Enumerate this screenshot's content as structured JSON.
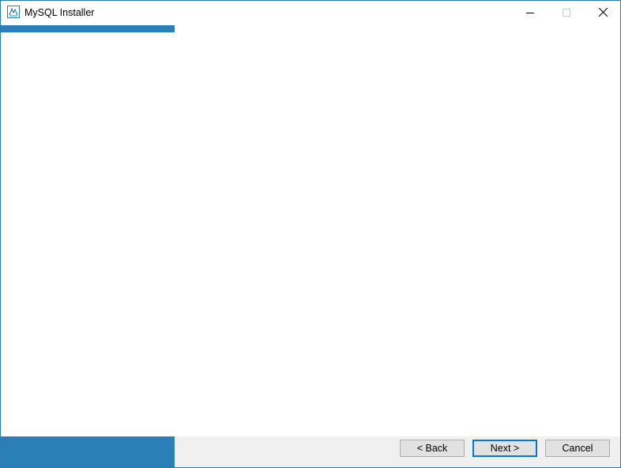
{
  "window": {
    "title": "MySQL Installer",
    "controls": {
      "minimize_icon": "minimize-icon",
      "maximize_icon": "maximize-icon",
      "close_icon": "close-icon"
    }
  },
  "colors": {
    "accent": "#2a7fb8",
    "footer_bg": "#f0f0f0",
    "default_button_border": "#0078d7"
  },
  "footer": {
    "back_label": "< Back",
    "next_label": "Next >",
    "cancel_label": "Cancel"
  }
}
